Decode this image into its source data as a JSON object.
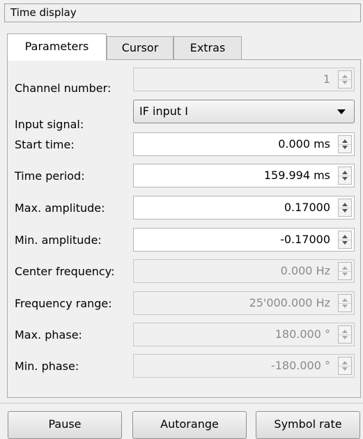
{
  "window": {
    "title": "Time display"
  },
  "tabs": [
    "Parameters",
    "Cursor",
    "Extras"
  ],
  "fields": {
    "channel_number": {
      "label": "Channel number:",
      "value": "1"
    },
    "input_signal": {
      "label": "Input signal:",
      "value": "IF input I"
    },
    "start_time": {
      "label": "Start time:",
      "value": "0.000 ms"
    },
    "time_period": {
      "label": "Time period:",
      "value": "159.994 ms"
    },
    "max_amplitude": {
      "label": "Max. amplitude:",
      "value": "0.17000"
    },
    "min_amplitude": {
      "label": "Min. amplitude:",
      "value": "-0.17000"
    },
    "center_frequency": {
      "label": "Center frequency:",
      "value": "0.000 Hz"
    },
    "frequency_range": {
      "label": "Frequency range:",
      "value": "25'000.000 Hz"
    },
    "max_phase": {
      "label": "Max. phase:",
      "value": "180.000 °"
    },
    "min_phase": {
      "label": "Min. phase:",
      "value": "-180.000 °"
    }
  },
  "buttons": {
    "pause": "Pause",
    "autorange": "Autorange",
    "symbol_rate": "Symbol rate"
  }
}
